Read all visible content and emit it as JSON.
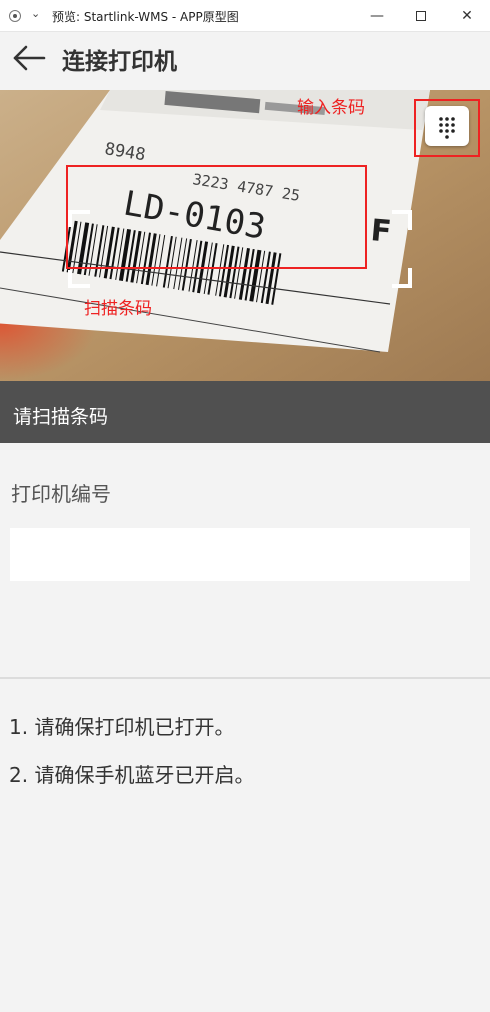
{
  "window": {
    "title": "预览: Startlink-WMS - APP原型图",
    "minimize_glyph": "—",
    "close_glyph": "✕"
  },
  "header": {
    "title": "连接打印机",
    "back_icon": "arrow-left-icon"
  },
  "scanner": {
    "keypad_icon": "keypad-dots-icon",
    "label_text": "LD-0103",
    "label_top_text": "3223 4787 25",
    "label_corner_text": "8948",
    "label_side_letter": "F"
  },
  "annotations": {
    "input_barcode": "输入条码",
    "scan_barcode": "扫描条码",
    "color": "#ee2222"
  },
  "scan_bar": {
    "label": "请扫描条码",
    "background": "#505050"
  },
  "form": {
    "printer_number_label": "打印机编号",
    "printer_number_value": "",
    "printer_number_placeholder": ""
  },
  "tips": [
    "1. 请确保打印机已打开。",
    "2. 请确保手机蓝牙已开启。"
  ]
}
